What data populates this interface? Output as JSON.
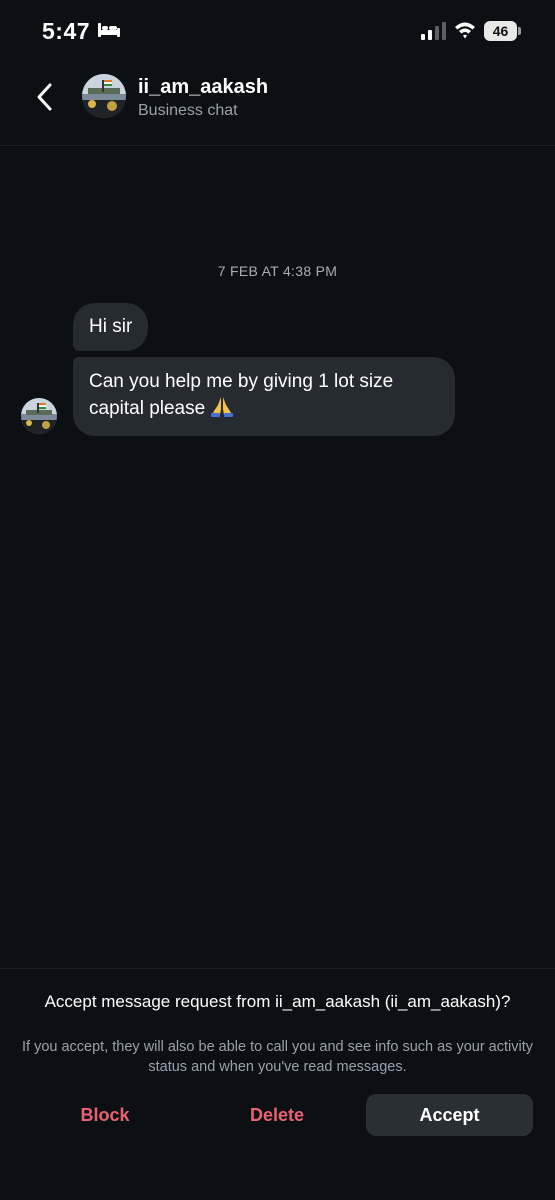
{
  "status_bar": {
    "time": "5:47",
    "battery": "46",
    "icons": [
      "bed-icon",
      "signal-icon",
      "wifi-icon",
      "battery-icon"
    ]
  },
  "header": {
    "username": "ii_am_aakash",
    "subtitle": "Business chat",
    "icons": [
      "back-chevron-icon",
      "avatar"
    ]
  },
  "conversation": {
    "timestamp": "7 FEB AT 4:38 PM",
    "messages": [
      {
        "text": "Hi sir"
      },
      {
        "text": "Can you help me by giving 1 lot size capital please",
        "emoji": "folded-hands-icon"
      }
    ]
  },
  "request": {
    "title": "Accept message request from ii_am_aakash (ii_am_aakash)?",
    "note": "If you accept, they will also be able to call you and see info such as your activity status and when you've read messages.",
    "block_label": "Block",
    "delete_label": "Delete",
    "accept_label": "Accept"
  },
  "colors": {
    "background": "#0c0f14",
    "bubble": "#262a31",
    "danger": "#e8636f",
    "secondary_text": "#9ba1ab"
  }
}
